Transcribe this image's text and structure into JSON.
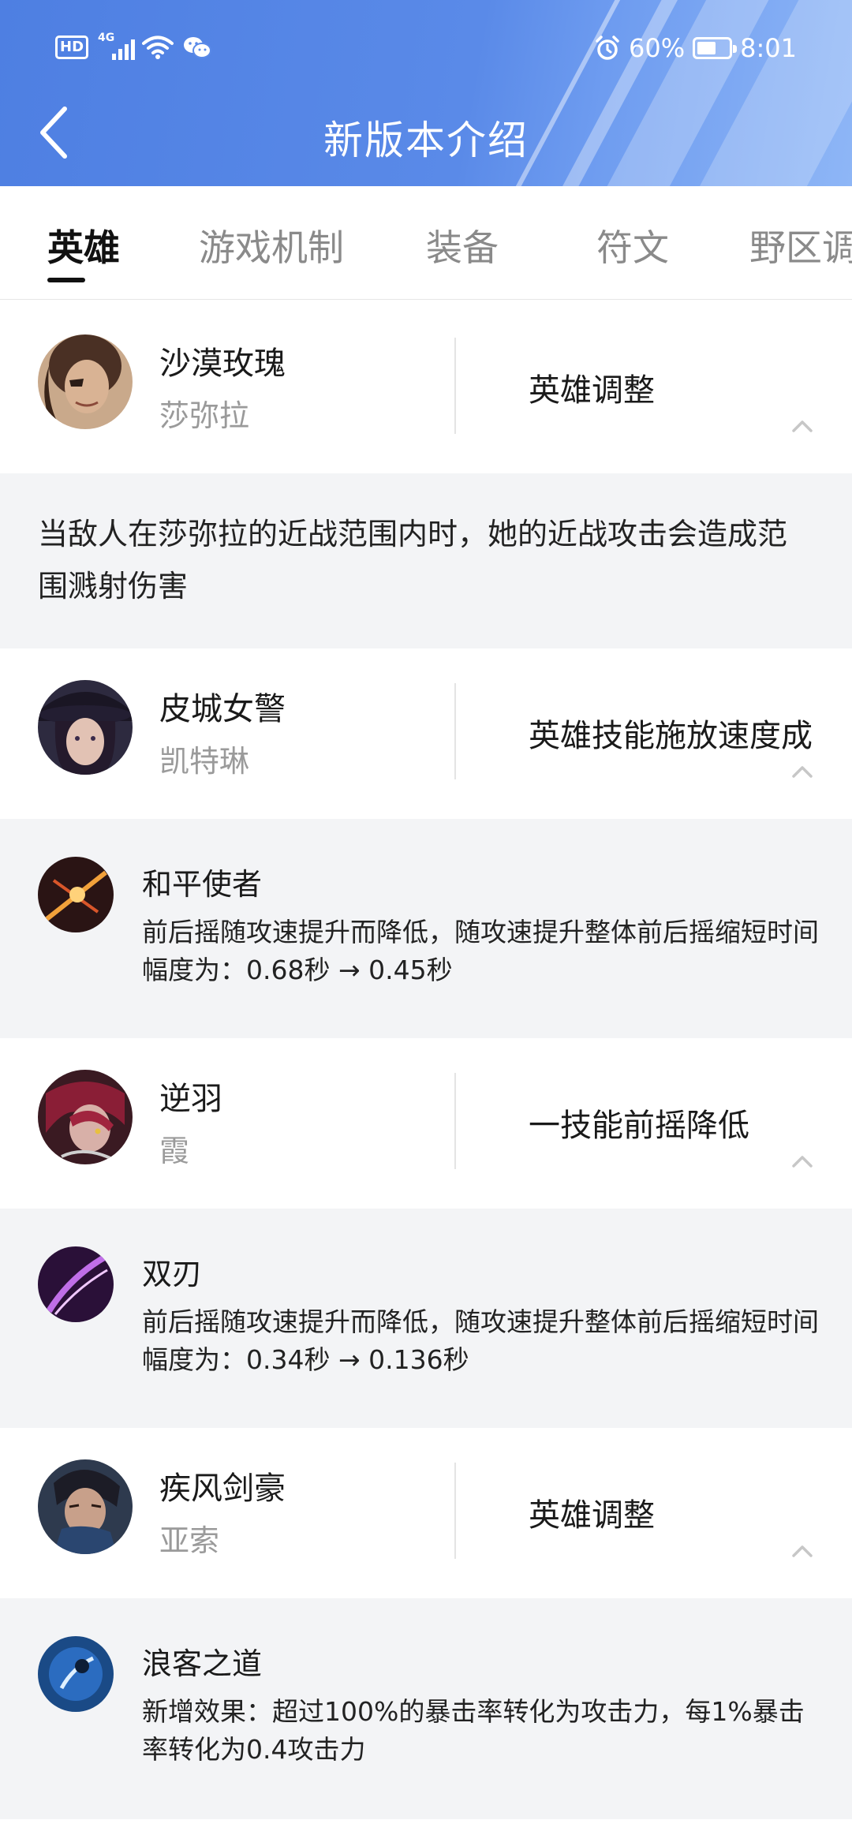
{
  "status": {
    "signal_label": "4G",
    "hd_label": "HD",
    "battery": "60%",
    "battery_level": 0.6,
    "time": "8:01"
  },
  "header": {
    "title": "新版本介绍"
  },
  "tabs": [
    {
      "label": "英雄",
      "active": true
    },
    {
      "label": "游戏机制"
    },
    {
      "label": "装备"
    },
    {
      "label": "符文"
    },
    {
      "label": "野区调"
    }
  ],
  "heroes": [
    {
      "name": "沙漠玫瑰",
      "champion": "莎弥拉",
      "change": "英雄调整",
      "description": "当敌人在莎弥拉的近战范围内时，她的近战攻击会造成范围溅射伤害"
    },
    {
      "name": "皮城女警",
      "champion": "凯特琳",
      "change": "英雄技能施放速度成",
      "skill": {
        "name": "和平使者",
        "text": "前后摇随攻速提升而降低，随攻速提升整体前后摇缩短时间幅度为：0.68秒 → 0.45秒"
      }
    },
    {
      "name": "逆羽",
      "champion": "霞",
      "change": "一技能前摇降低",
      "skill": {
        "name": "双刃",
        "text": "前后摇随攻速提升而降低，随攻速提升整体前后摇缩短时间幅度为：0.34秒 → 0.136秒"
      }
    },
    {
      "name": "疾风剑豪",
      "champion": "亚索",
      "change": "英雄调整",
      "skill": {
        "name": "浪客之道",
        "text": "新增效果：超过100%的暴击率转化为攻击力，每1%暴击率转化为0.4攻击力"
      }
    }
  ],
  "colors": {
    "header_blue": "#4e7fe2",
    "panel_gray": "#f3f4f6"
  }
}
